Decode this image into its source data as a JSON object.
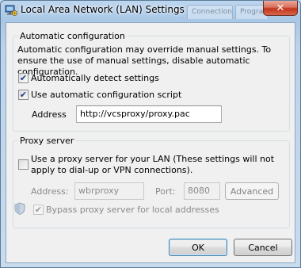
{
  "window": {
    "title": "Local Area Network (LAN) Settings",
    "close_glyph": "✕",
    "background_tabs": [
      "Connections",
      "Programs"
    ]
  },
  "automatic_configuration": {
    "group_label": "Automatic configuration",
    "description": "Automatic configuration may override manual settings.  To ensure the use of manual settings, disable automatic configuration.",
    "auto_detect": {
      "label": "Automatically detect settings",
      "checked": true
    },
    "use_script": {
      "label": "Use automatic configuration script",
      "checked": true
    },
    "address_label": "Address",
    "address_value": "http://vcsproxy/proxy.pac"
  },
  "proxy_server": {
    "group_label": "Proxy server",
    "use_proxy": {
      "label": "Use a proxy server for your LAN (These settings will not apply to dial-up or VPN connections).",
      "checked": false
    },
    "address_label": "Address:",
    "address_value": "wbrproxy",
    "port_label": "Port:",
    "port_value": "8080",
    "advanced_label": "Advanced",
    "bypass": {
      "label": "Bypass proxy server for local addresses",
      "checked": true,
      "enabled": false
    }
  },
  "buttons": {
    "ok": "OK",
    "cancel": "Cancel"
  },
  "icons": {
    "title": "network-settings-icon",
    "shield": "uac-shield-icon",
    "check": "checkmark-icon"
  },
  "colors": {
    "titlebar": "#a9c7e6",
    "close_button": "#c2341a",
    "dialog_face": "#f0f0f0",
    "check": "#1f3f87"
  }
}
